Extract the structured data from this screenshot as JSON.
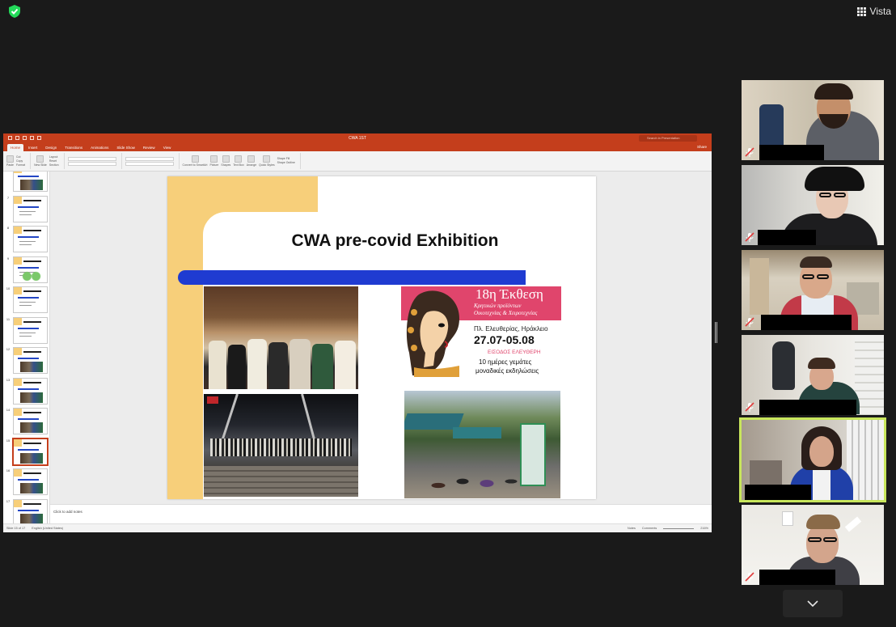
{
  "topbar": {
    "security_icon": "shield-check-icon",
    "security_color": "#23d959",
    "view_label": "Vista",
    "view_icon": "grid-view-icon"
  },
  "shared_screen": {
    "app": "PowerPoint",
    "window_title": "CWA 1ST",
    "search_placeholder": "Search in Presentation",
    "accent": "#c43e1c",
    "tabs": [
      "Home",
      "Insert",
      "Design",
      "Transitions",
      "Animations",
      "Slide Show",
      "Review",
      "View"
    ],
    "active_tab": "Home",
    "share_label": "Share",
    "ribbon": {
      "paste": "Paste",
      "cut": "Cut",
      "copy": "Copy",
      "format": "Format",
      "new_slide": "New Slide",
      "layout": "Layout",
      "reset": "Reset",
      "section": "Section",
      "font_name": "Arial",
      "font_size": "20",
      "convert": "Convert to SmartArt",
      "picture": "Picture",
      "shapes": "Shapes",
      "textbox": "Text Box",
      "arrange": "Arrange",
      "quick_styles": "Quick Styles",
      "shape_fill": "Shape Fill",
      "shape_outline": "Shape Outline"
    },
    "thumbnails": [
      {
        "num": "",
        "kind": "photo"
      },
      {
        "num": "7",
        "kind": "text"
      },
      {
        "num": "8",
        "kind": "text"
      },
      {
        "num": "9",
        "kind": "green"
      },
      {
        "num": "10",
        "kind": "text"
      },
      {
        "num": "11",
        "kind": "text"
      },
      {
        "num": "12",
        "kind": "photo"
      },
      {
        "num": "13",
        "kind": "photo"
      },
      {
        "num": "14",
        "kind": "photo"
      },
      {
        "num": "15",
        "kind": "photo",
        "selected": true
      },
      {
        "num": "16",
        "kind": "photo"
      },
      {
        "num": "17",
        "kind": "photo"
      }
    ],
    "slide": {
      "title": "CWA pre-covid Exhibition",
      "gold": "#f7cf7a",
      "blue": "#1f3bd1",
      "poster": {
        "heading": "18η Έκθεση",
        "line1": "Κρητικών προϊόντων",
        "line2": "Οικοτεχνίας & Χειροτεχνίας",
        "location": "Πλ. Ελευθερίας, Ηράκλειο",
        "dates": "27.07-05.08",
        "free_entry": "ΕΙΣΟΔΟΣ ΕΛΕΥΘΕΡΗ",
        "days1": "10 ημέρες γεμάτες",
        "days2": "μοναδικές εκδηλώσεις",
        "pink": "#e0456c"
      }
    },
    "notes_placeholder": "Click to add notes",
    "status": {
      "slide_count": "Slide 15 of 17",
      "language": "English (United States)",
      "notes": "Notes",
      "comments": "Comments",
      "zoom": "216%"
    }
  },
  "participants": [
    {
      "mic": "mic-muted-icon",
      "active": false
    },
    {
      "mic": "mic-muted-icon",
      "active": false
    },
    {
      "mic": "mic-muted-icon",
      "active": false
    },
    {
      "mic": "mic-muted-icon",
      "active": false
    },
    {
      "mic": "",
      "active": true
    },
    {
      "mic": "mic-muted-icon",
      "active": false
    }
  ],
  "gallery": {
    "more_icon": "chevron-down-icon"
  }
}
